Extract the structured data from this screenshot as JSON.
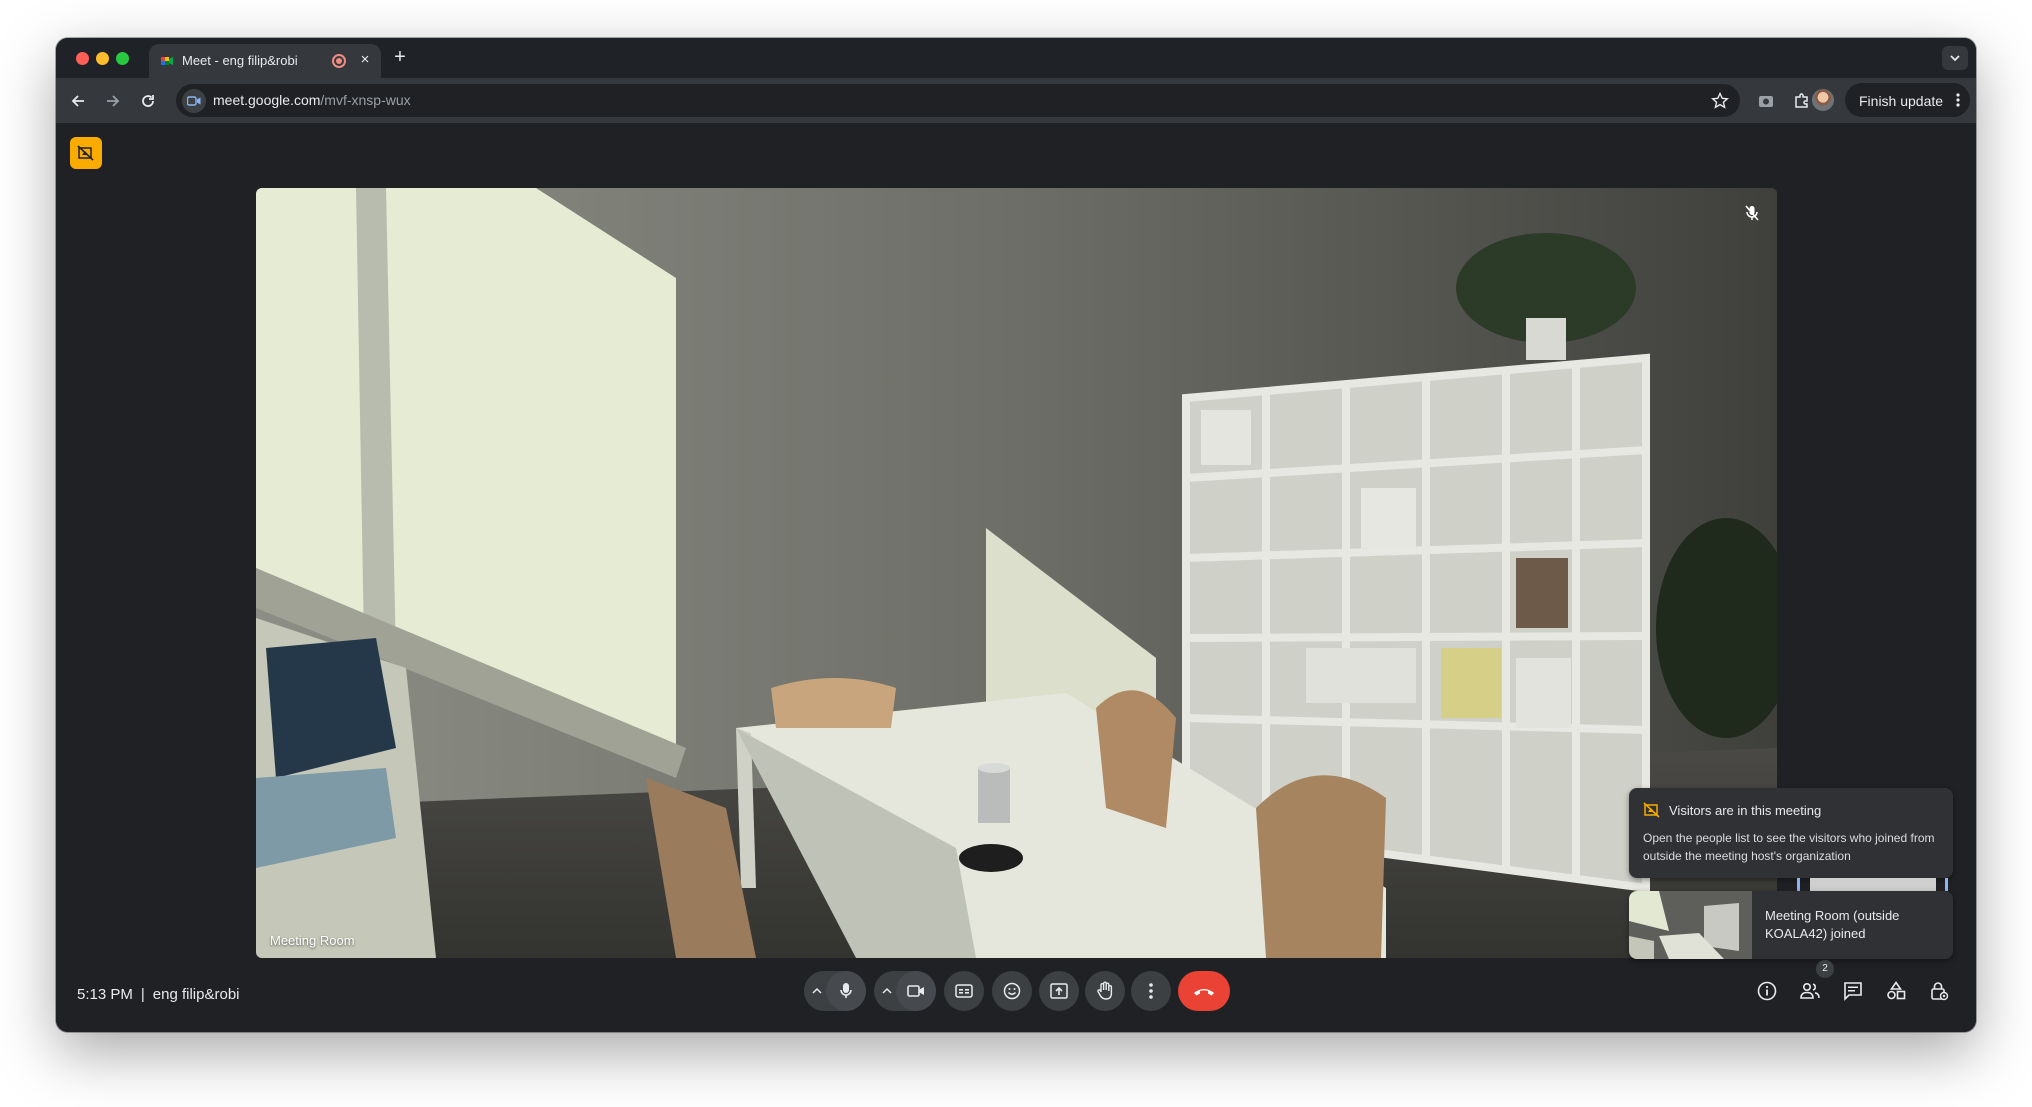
{
  "browser": {
    "tab": {
      "title": "Meet - eng filip&robi",
      "close": "×"
    },
    "new_tab": "+",
    "url": {
      "host": "meet.google.com",
      "path": "/mvf-xnsp-wux"
    },
    "finish_update": "Finish update"
  },
  "meeting": {
    "time": "5:13 PM",
    "separator": "|",
    "name": "eng filip&robi",
    "tile_name": "Meeting Room",
    "people_count": "2"
  },
  "toasts": {
    "visitors_title": "Visitors are in this meeting",
    "visitors_body": "Open the people list to see the visitors who joined from outside the meeting host's organization",
    "joined_text": "Meeting Room (outside KOALA42) joined"
  },
  "icons": {
    "back": "arrow-left-icon",
    "forward": "arrow-right-icon",
    "reload": "reload-icon",
    "star": "star-icon",
    "extensions": "puzzle-icon",
    "mic": "mic-icon",
    "camera": "camera-icon",
    "captions": "captions-icon",
    "emoji": "emoji-icon",
    "present": "present-icon",
    "hand": "raise-hand-icon",
    "more": "more-vert-icon",
    "leave": "call-end-icon",
    "info": "info-icon",
    "people": "people-icon",
    "chat": "chat-icon",
    "activities": "activities-icon",
    "host_controls": "lock-icon"
  },
  "colors": {
    "leave": "#ea4335",
    "visitor_badge": "#f9ab00",
    "surface": "#202124"
  }
}
